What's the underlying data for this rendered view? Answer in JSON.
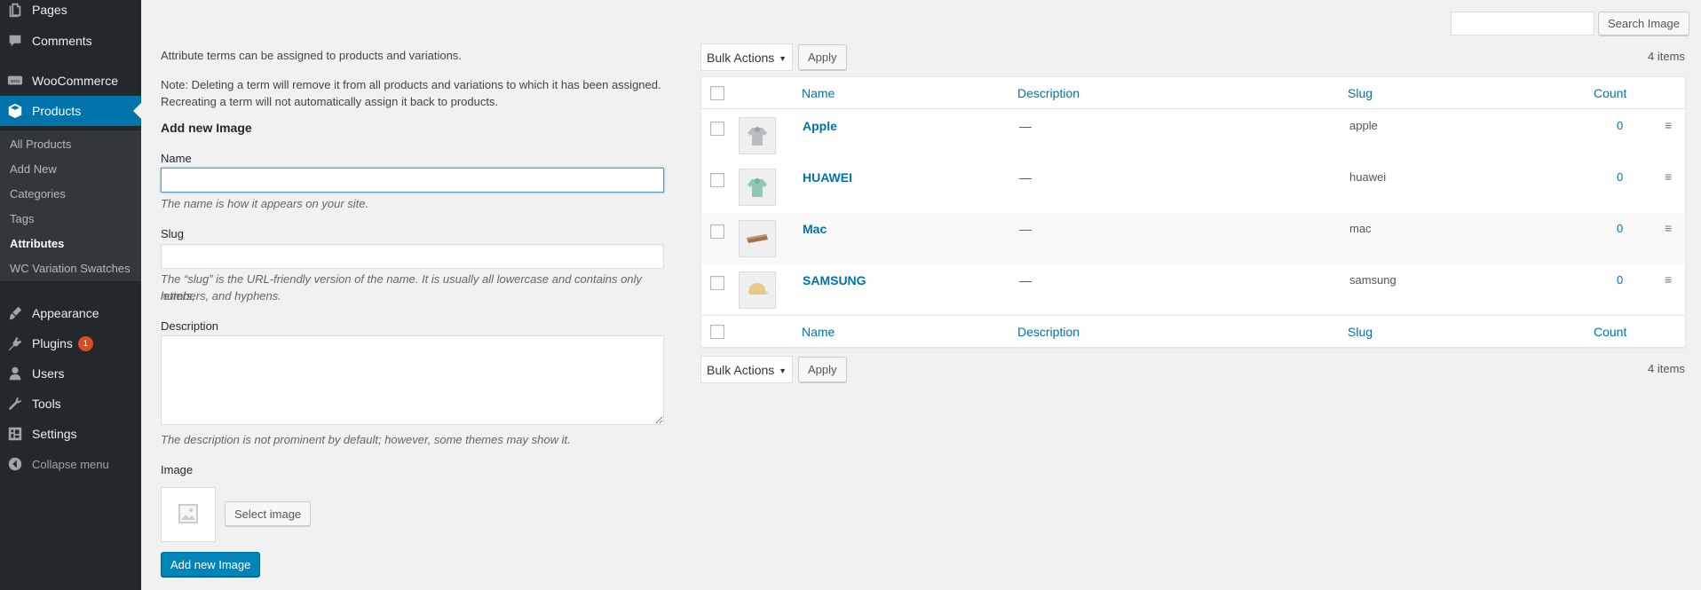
{
  "sidebar": {
    "top_items": [
      {
        "label": "Pages",
        "icon": "pages-icon"
      },
      {
        "label": "Comments",
        "icon": "comments-icon"
      },
      {
        "label": "WooCommerce",
        "icon": "woocommerce-icon"
      },
      {
        "label": "Products",
        "icon": "products-icon",
        "current": true
      }
    ],
    "submenu": [
      {
        "label": "All Products"
      },
      {
        "label": "Add New"
      },
      {
        "label": "Categories"
      },
      {
        "label": "Tags"
      },
      {
        "label": "Attributes",
        "current": true
      },
      {
        "label": "WC Variation Swatches"
      }
    ],
    "bottom_items": [
      {
        "label": "Appearance",
        "icon": "appearance-icon"
      },
      {
        "label": "Plugins",
        "icon": "plugins-icon",
        "badge": "1"
      },
      {
        "label": "Users",
        "icon": "users-icon"
      },
      {
        "label": "Tools",
        "icon": "tools-icon"
      },
      {
        "label": "Settings",
        "icon": "settings-icon"
      }
    ],
    "collapse_label": "Collapse menu"
  },
  "form": {
    "intro": "Attribute terms can be assigned to products and variations.",
    "note_line1": "Note: Deleting a term will remove it from all products and variations to which it has been assigned.",
    "note_line2": "Recreating a term will not automatically assign it back to products.",
    "heading": "Add new Image",
    "name_label": "Name",
    "name_value": "",
    "name_desc": "The name is how it appears on your site.",
    "slug_label": "Slug",
    "slug_value": "",
    "slug_desc_line1": "The “slug” is the URL-friendly version of the name. It is usually all lowercase and contains only letters,",
    "slug_desc_line2": "numbers, and hyphens.",
    "description_label": "Description",
    "description_value": "",
    "description_desc": "The description is not prominent by default; however, some themes may show it.",
    "image_label": "Image",
    "select_image_button": "Select image",
    "submit_button": "Add new Image"
  },
  "search": {
    "value": "",
    "button": "Search Image"
  },
  "tablenav": {
    "bulk_actions": "Bulk Actions",
    "apply": "Apply",
    "items_count": "4 items"
  },
  "table": {
    "columns": {
      "name": "Name",
      "description": "Description",
      "slug": "Slug",
      "count": "Count"
    },
    "rows": [
      {
        "name": "Apple",
        "description": "—",
        "slug": "apple",
        "count": "0",
        "thumb": "hoodie-grey"
      },
      {
        "name": "HUAWEI",
        "description": "—",
        "slug": "huawei",
        "count": "0",
        "thumb": "hoodie-green"
      },
      {
        "name": "Mac",
        "description": "—",
        "slug": "mac",
        "count": "0",
        "thumb": "belt"
      },
      {
        "name": "SAMSUNG",
        "description": "—",
        "slug": "samsung",
        "count": "0",
        "thumb": "cap"
      }
    ]
  },
  "colors": {
    "sidebar_bg": "#23282d",
    "accent": "#0073aa",
    "primary_button": "#0085ba",
    "badge": "#d54e21"
  }
}
